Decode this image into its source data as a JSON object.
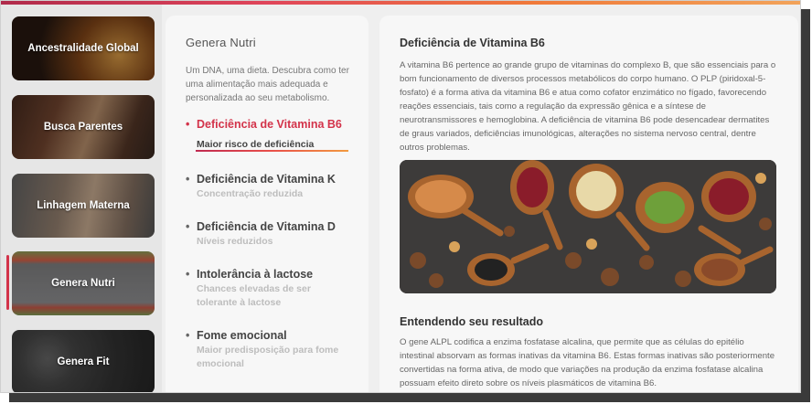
{
  "sidebar": {
    "items": [
      {
        "label": "Ancestralidade Global"
      },
      {
        "label": "Busca Parentes"
      },
      {
        "label": "Linhagem Materna"
      },
      {
        "label": "Genera Nutri"
      },
      {
        "label": "Genera Fit"
      }
    ],
    "active_index": 3
  },
  "nutri": {
    "title": "Genera Nutri",
    "intro": "Um DNA, uma dieta. Descubra como ter uma alimentação mais adequada e personalizada ao seu metabolismo.",
    "items": [
      {
        "title": "Deficiência de Vitamina B6",
        "subtitle": "Maior risco de deficiência"
      },
      {
        "title": "Deficiência de Vitamina K",
        "subtitle": "Concentração reduzida"
      },
      {
        "title": "Deficiência de Vitamina D",
        "subtitle": "Níveis reduzidos"
      },
      {
        "title": "Intolerância à lactose",
        "subtitle": "Chances elevadas de ser tolerante à lactose"
      },
      {
        "title": "Fome emocional",
        "subtitle": "Maior predisposição para fome emocional"
      }
    ]
  },
  "detail": {
    "title": "Deficiência de Vitamina B6",
    "body": "A vitamina B6 pertence ao grande grupo de vitaminas do complexo B, que são essenciais para o bom funcionamento de diversos processos metabólicos do corpo humano. O PLP (piridoxal-5-fosfato) é a forma ativa da vitamina B6 e atua como cofator enzimático no fígado, favorecendo reações essenciais, tais como a regulação da expressão gênica e a síntese de neurotransmissores e hemoglobina. A deficiência de vitamina B6 pode desencadear dermatites de graus variados, deficiências imunológicas, alterações no sistema nervoso central, dentre outros problemas.",
    "section_title": "Entendendo seu resultado",
    "section_body": "O gene ALPL codifica a enzima fosfatase alcalina, que permite que as células do epitélio intestinal absorvam as formas inativas da vitamina B6. Estas formas inativas são posteriormente convertidas na forma ativa, de modo que variações na produção da enzima fosfatase alcalina possuam efeito direto sobre os níveis plasmáticos de vitamina B6."
  },
  "colors": {
    "accent": "#d3334a",
    "gradient_end": "#f29a40"
  }
}
